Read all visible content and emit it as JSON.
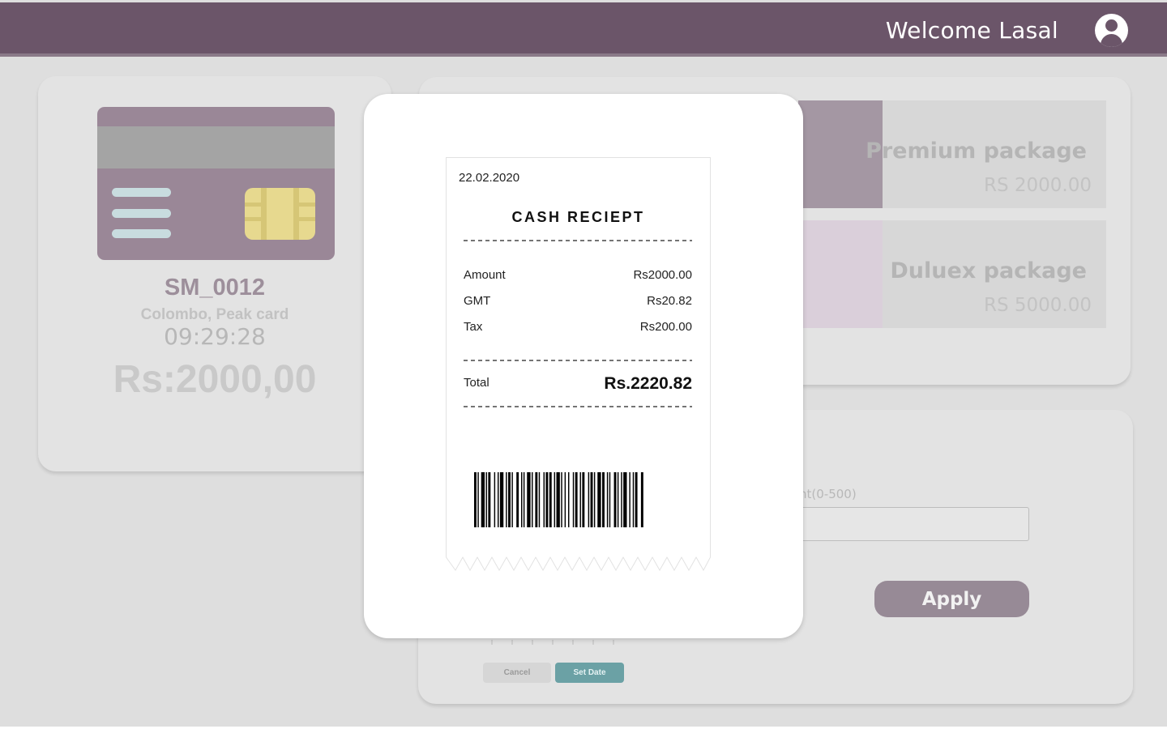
{
  "header": {
    "welcome_text": "Welcome Lasal",
    "avatar_icon": "user-circle-icon",
    "bar_color": "#6b5569"
  },
  "card_panel": {
    "card_icon": "credit-card-icon",
    "card_id": "SM_0012",
    "location": "Colombo, Peak card",
    "time": "09:29:28",
    "amount": "Rs:2000,00"
  },
  "packages": [
    {
      "name": "Premium package",
      "price": "RS 2000.00",
      "color": "#a497a3"
    },
    {
      "name": "Duluex package",
      "price": "RS 5000.00",
      "color": "#dacfda"
    }
  ],
  "adjust_panel": {
    "amount_label": "nt(0-500)",
    "amount_value": "",
    "apply_label": "Apply",
    "cancel_label": "Cancel",
    "set_date_label": "Set Date",
    "set_date_color": "#6ba1a5"
  },
  "receipt": {
    "date": "22.02.2020",
    "title": "CASH RECIEPT",
    "items": [
      {
        "label": "Amount",
        "value": "Rs2000.00"
      },
      {
        "label": "GMT",
        "value": "Rs20.82"
      },
      {
        "label": "Tax",
        "value": "Rs200.00"
      }
    ],
    "total_label": "Total",
    "total_value": "Rs.2220.82",
    "barcode_icon": "barcode-icon"
  }
}
